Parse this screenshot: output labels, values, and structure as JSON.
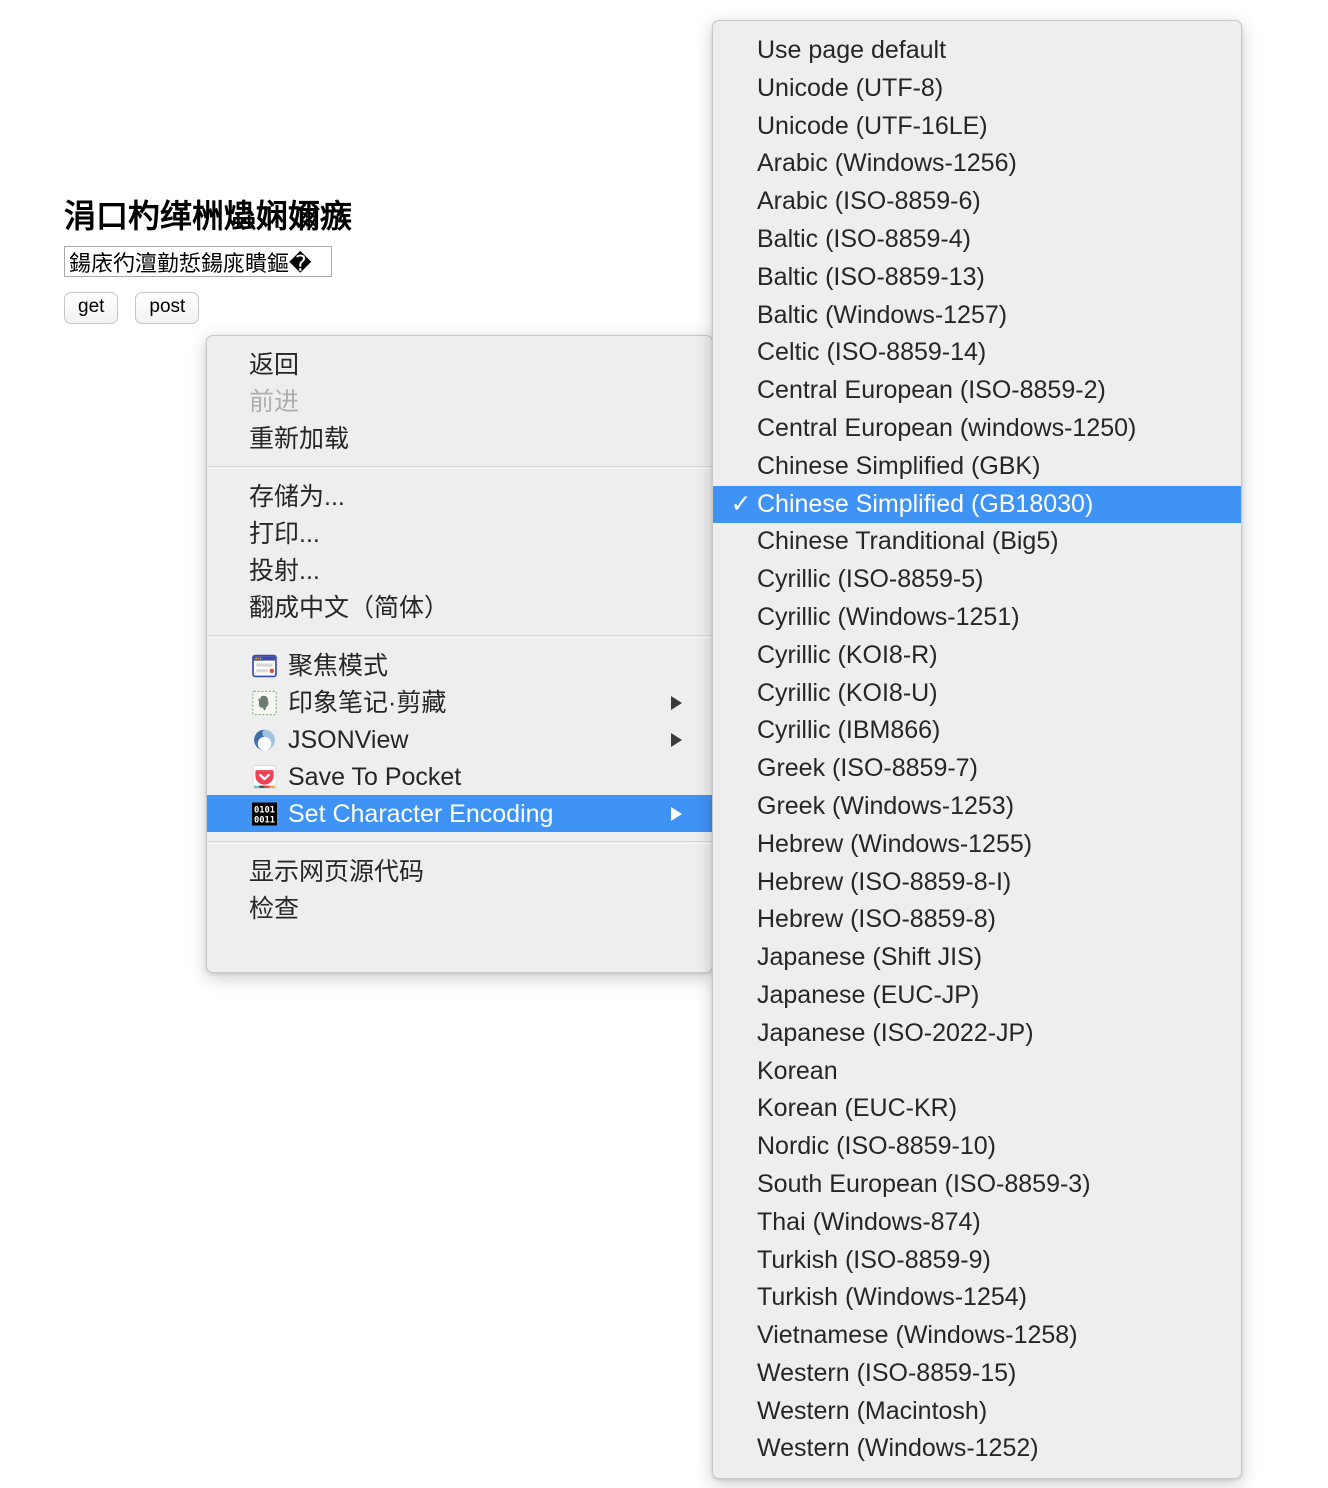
{
  "page": {
    "heading": "涓口杓缂栦爞娴嬭瘯",
    "input_value": "鍚庡彴澶勭悊鍚庣瞶鏂�",
    "input_placeholder": "",
    "buttons": [
      {
        "label": "get",
        "name": "get-button"
      },
      {
        "label": "post",
        "name": "post-button"
      }
    ]
  },
  "context_menu": {
    "groups": [
      {
        "items": [
          {
            "label": "返回",
            "disabled": false,
            "icon": null,
            "submenu": false,
            "highlighted": false
          },
          {
            "label": "前进",
            "disabled": true,
            "icon": null,
            "submenu": false,
            "highlighted": false
          },
          {
            "label": "重新加载",
            "disabled": false,
            "icon": null,
            "submenu": false,
            "highlighted": false
          }
        ]
      },
      {
        "items": [
          {
            "label": "存储为...",
            "disabled": false,
            "icon": null,
            "submenu": false,
            "highlighted": false
          },
          {
            "label": "打印...",
            "disabled": false,
            "icon": null,
            "submenu": false,
            "highlighted": false
          },
          {
            "label": "投射...",
            "disabled": false,
            "icon": null,
            "submenu": false,
            "highlighted": false
          },
          {
            "label": "翻成中文（简体）",
            "disabled": false,
            "icon": null,
            "submenu": false,
            "highlighted": false
          }
        ]
      },
      {
        "items": [
          {
            "label": "聚焦模式",
            "disabled": false,
            "icon": "browser-window-icon",
            "submenu": false,
            "highlighted": false
          },
          {
            "label": "印象笔记·剪藏",
            "disabled": false,
            "icon": "evernote-elephant-icon",
            "submenu": true,
            "highlighted": false
          },
          {
            "label": "JSONView",
            "disabled": false,
            "icon": "jsonview-swirl-icon",
            "submenu": true,
            "highlighted": false
          },
          {
            "label": "Save To Pocket",
            "disabled": false,
            "icon": "pocket-shield-icon",
            "submenu": false,
            "highlighted": false
          },
          {
            "label": "Set Character Encoding",
            "disabled": false,
            "icon": "binary-0101-icon",
            "submenu": true,
            "highlighted": true
          }
        ]
      },
      {
        "items": [
          {
            "label": "显示网页源代码",
            "disabled": false,
            "icon": null,
            "submenu": false,
            "highlighted": false
          },
          {
            "label": "检查",
            "disabled": false,
            "icon": null,
            "submenu": false,
            "highlighted": false
          }
        ]
      }
    ]
  },
  "encoding_submenu": {
    "checkmark": "✓",
    "selected": "Chinese Simplified (GB18030)",
    "items": [
      "Use page default",
      "Unicode (UTF-8)",
      "Unicode (UTF-16LE)",
      "Arabic (Windows-1256)",
      "Arabic (ISO-8859-6)",
      "Baltic (ISO-8859-4)",
      "Baltic (ISO-8859-13)",
      "Baltic (Windows-1257)",
      "Celtic (ISO-8859-14)",
      "Central European (ISO-8859-2)",
      "Central European (windows-1250)",
      "Chinese Simplified (GBK)",
      "Chinese Simplified (GB18030)",
      "Chinese Tranditional (Big5)",
      "Cyrillic (ISO-8859-5)",
      "Cyrillic (Windows-1251)",
      "Cyrillic (KOI8-R)",
      "Cyrillic (KOI8-U)",
      "Cyrillic (IBM866)",
      "Greek (ISO-8859-7)",
      "Greek (Windows-1253)",
      "Hebrew (Windows-1255)",
      "Hebrew (ISO-8859-8-I)",
      "Hebrew (ISO-8859-8)",
      "Japanese (Shift JIS)",
      "Japanese (EUC-JP)",
      "Japanese (ISO-2022-JP)",
      "Korean",
      "Korean (EUC-KR)",
      "Nordic (ISO-8859-10)",
      "South European (ISO-8859-3)",
      "Thai (Windows-874)",
      "Turkish (ISO-8859-9)",
      "Turkish (Windows-1254)",
      "Vietnamese (Windows-1258)",
      "Western (ISO-8859-15)",
      "Western (Macintosh)",
      "Western (Windows-1252)"
    ]
  },
  "colors": {
    "highlight": "#3f93f4",
    "menu_background": "#eeeeee",
    "menu_text": "#262626",
    "disabled_text": "#aeaeae"
  }
}
